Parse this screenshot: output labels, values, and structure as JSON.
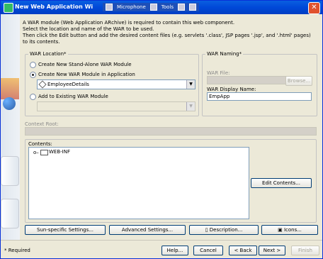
{
  "window": {
    "title": "New Web Application Wi",
    "toolbar_items": [
      "Microphone",
      "Tools"
    ]
  },
  "intro": {
    "line1": "A WAR module (Web Application ARchive) is required to contain this web component.",
    "line2": "Select the location and name of the WAR to be used.",
    "line3": "Then click the Edit button and add the desired content files (e.g. servlets '.class', JSP pages '.jsp', and '.html' pages) to its contents."
  },
  "war_location": {
    "legend": "WAR Location*",
    "option1": "Create New Stand-Alone WAR Module",
    "option2": "Create New WAR Module in Application",
    "app_combo_value": "EmployeeDetails",
    "option3": "Add to Existing WAR Module",
    "existing_combo_value": ""
  },
  "war_naming": {
    "legend": "WAR Naming*",
    "war_file_label": "WAR File:",
    "war_file_value": "",
    "browse_label": "Browse...",
    "display_name_label": "WAR Display Name:",
    "display_name_value": "EmpApp"
  },
  "context_root": {
    "label": "Context Root:",
    "value": ""
  },
  "contents": {
    "label": "Contents:",
    "tree_item": "WEB-INF",
    "edit_button": "Edit Contents..."
  },
  "action_buttons": {
    "sun_specific": "Sun-specific Settings...",
    "advanced": "Advanced Settings...",
    "description": "Description...",
    "icons": "Icons..."
  },
  "footer": {
    "required_note": "* Required",
    "help": "Help...",
    "cancel": "Cancel",
    "back": "< Back",
    "next": "Next >",
    "finish": "Finish"
  },
  "icons": {
    "app_icon": "app-icon",
    "close": "close-icon",
    "folder": "folder-icon",
    "tree_expander": "tree-expander-icon"
  }
}
